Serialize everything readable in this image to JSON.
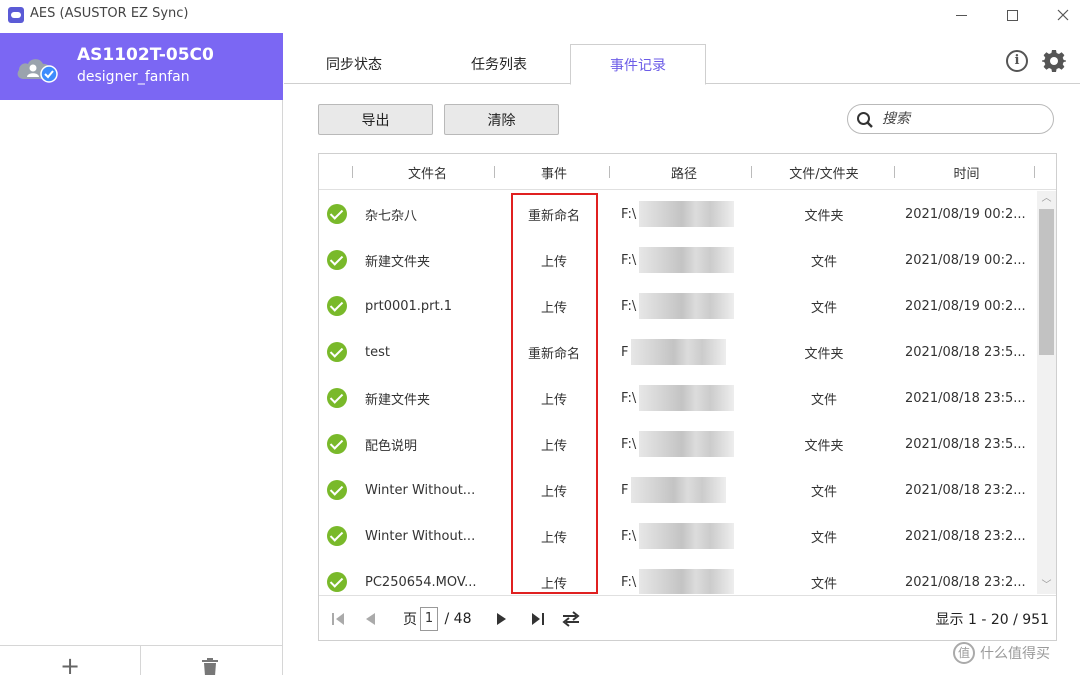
{
  "window": {
    "title": "AES (ASUSTOR EZ Sync)"
  },
  "sidebar": {
    "device_name": "AS1102T-05C0",
    "device_user": "designer_fanfan",
    "add_label": "+"
  },
  "tabs": [
    {
      "label": "同步状态",
      "active": false
    },
    {
      "label": "任务列表",
      "active": false
    },
    {
      "label": "事件记录",
      "active": true
    }
  ],
  "toolbar": {
    "export_label": "导出",
    "clear_label": "清除",
    "search_placeholder": "搜索"
  },
  "table": {
    "headers": [
      "文件名",
      "事件",
      "路径",
      "文件/文件夹",
      "时间"
    ],
    "rows": [
      {
        "name": "杂七杂八",
        "event": "重新命名",
        "path": "F:\\",
        "type": "文件夹",
        "time": "2021/08/19 00:2..."
      },
      {
        "name": "新建文件夹",
        "event": "上传",
        "path": "F:\\",
        "type": "文件",
        "time": "2021/08/19 00:2..."
      },
      {
        "name": "prt0001.prt.1",
        "event": "上传",
        "path": "F:\\",
        "type": "文件",
        "time": "2021/08/19 00:2..."
      },
      {
        "name": "test",
        "event": "重新命名",
        "path": "F",
        "type": "文件夹",
        "time": "2021/08/18 23:5..."
      },
      {
        "name": "新建文件夹",
        "event": "上传",
        "path": "F:\\",
        "type": "文件",
        "time": "2021/08/18 23:5..."
      },
      {
        "name": "配色说明",
        "event": "上传",
        "path": "F:\\",
        "type": "文件夹",
        "time": "2021/08/18 23:5..."
      },
      {
        "name": "Winter Without...",
        "event": "上传",
        "path": "F",
        "type": "文件",
        "time": "2021/08/18 23:2..."
      },
      {
        "name": "Winter Without...",
        "event": "上传",
        "path": "F:\\",
        "type": "文件",
        "time": "2021/08/18 23:2..."
      },
      {
        "name": "PC250654.MOV...",
        "event": "上传",
        "path": "F:\\",
        "type": "文件",
        "time": "2021/08/18 23:2..."
      }
    ]
  },
  "pager": {
    "page_label": "页",
    "current_page": "1",
    "total_pages": "/ 48",
    "summary": "显示 1 - 20 / 951"
  },
  "watermark": {
    "badge": "值",
    "text": "什么值得买"
  },
  "colors": {
    "accent": "#7b67f3",
    "active_tab_text": "#6c5ce7",
    "success": "#79b92a",
    "highlight": "#e02020"
  }
}
